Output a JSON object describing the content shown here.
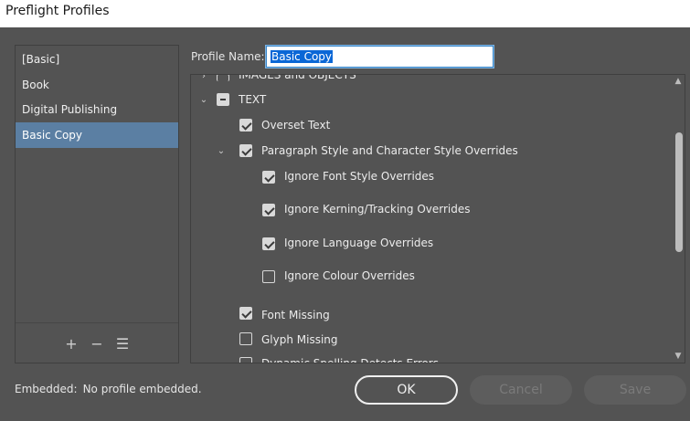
{
  "window": {
    "title": "Preflight Profiles"
  },
  "profiles": {
    "items": [
      {
        "label": "[Basic]",
        "selected": false
      },
      {
        "label": "Book",
        "selected": false
      },
      {
        "label": "Digital Publishing",
        "selected": false
      },
      {
        "label": "Basic Copy",
        "selected": true
      }
    ],
    "add_icon": "plus-icon",
    "remove_icon": "minus-icon",
    "menu_icon": "hamburger-menu-icon"
  },
  "profile_name": {
    "label": "Profile Name:",
    "value": "Basic Copy"
  },
  "tree": {
    "rows": [
      {
        "label": "IMAGES and OBJECTS",
        "state": "unchecked",
        "expanded": false,
        "level": 0,
        "partially_visible": true
      },
      {
        "label": "TEXT",
        "state": "mixed",
        "expanded": true,
        "level": 0
      },
      {
        "label": "Overset Text",
        "state": "checked",
        "level": 1
      },
      {
        "label": "Paragraph Style and Character Style Overrides",
        "state": "checked",
        "expanded": true,
        "level": 1
      },
      {
        "label": "Ignore Font Style Overrides",
        "state": "checked",
        "level": 2
      },
      {
        "label": "Ignore Kerning/Tracking Overrides",
        "state": "checked",
        "level": 2
      },
      {
        "label": "Ignore Language Overrides",
        "state": "checked",
        "level": 2
      },
      {
        "label": "Ignore Colour Overrides",
        "state": "unchecked",
        "level": 2
      },
      {
        "label": "Font Missing",
        "state": "checked",
        "level": 1
      },
      {
        "label": "Glyph Missing",
        "state": "unchecked",
        "level": 1
      },
      {
        "label": "Dynamic Spelling Detects Errors",
        "state": "unchecked",
        "level": 1,
        "partially_visible": true
      }
    ]
  },
  "footer": {
    "embedded_label": "Embedded:",
    "embedded_value": "No profile embedded.",
    "ok_label": "OK",
    "cancel_label": "Cancel",
    "save_label": "Save"
  },
  "colors": {
    "background": "#535353",
    "selection": "#5b7fa3",
    "input_selection": "#0a67d6"
  }
}
